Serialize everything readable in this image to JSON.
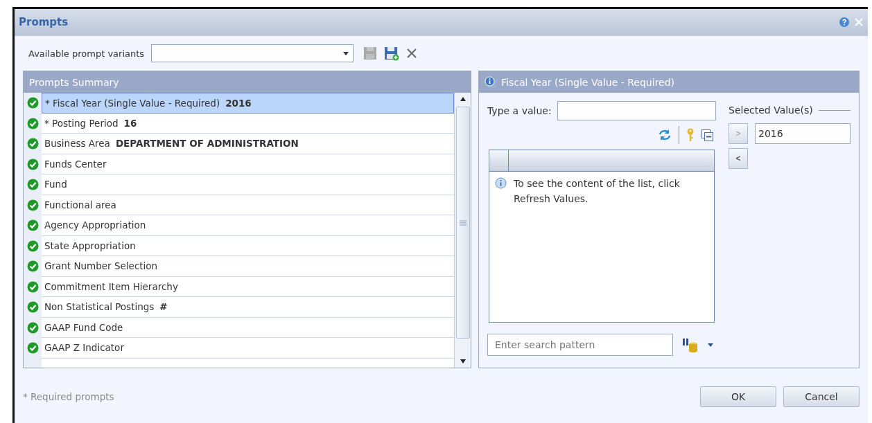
{
  "window": {
    "title": "Prompts"
  },
  "variants": {
    "label": "Available prompt variants"
  },
  "summary": {
    "title": "Prompts Summary",
    "rows": [
      {
        "label": "* Fiscal Year (Single Value - Required)",
        "value": "2016",
        "selected": true,
        "done": true
      },
      {
        "label": "* Posting Period",
        "value": "16",
        "selected": false,
        "done": true
      },
      {
        "label": "Business Area",
        "value": "DEPARTMENT OF ADMINISTRATION",
        "selected": false,
        "done": true
      },
      {
        "label": "Funds Center",
        "selected": false,
        "done": true
      },
      {
        "label": "Fund",
        "selected": false,
        "done": true
      },
      {
        "label": "Functional area",
        "selected": false,
        "done": true
      },
      {
        "label": "Agency Appropriation",
        "selected": false,
        "done": true
      },
      {
        "label": "State Appropriation",
        "selected": false,
        "done": true
      },
      {
        "label": "Grant Number Selection",
        "selected": false,
        "done": true
      },
      {
        "label": "Commitment Item Hierarchy",
        "selected": false,
        "done": true
      },
      {
        "label": "Non Statistical Postings",
        "value": "#",
        "selected": false,
        "done": true
      },
      {
        "label": "GAAP Fund Code",
        "selected": false,
        "done": true
      },
      {
        "label": "GAAP Z Indicator",
        "selected": false,
        "done": true
      }
    ]
  },
  "detail": {
    "title": "Fiscal Year (Single Value - Required)",
    "type_label": "Type a value:",
    "list_message": "To see the content of the list, click Refresh Values.",
    "search": {
      "placeholder": "Enter search pattern"
    },
    "selected_label": "Selected Value(s)",
    "selected_value": "2016",
    "add_button": ">",
    "remove_button": "<"
  },
  "footer": {
    "note": "* Required prompts",
    "buttons": [
      "OK",
      "Cancel"
    ]
  }
}
